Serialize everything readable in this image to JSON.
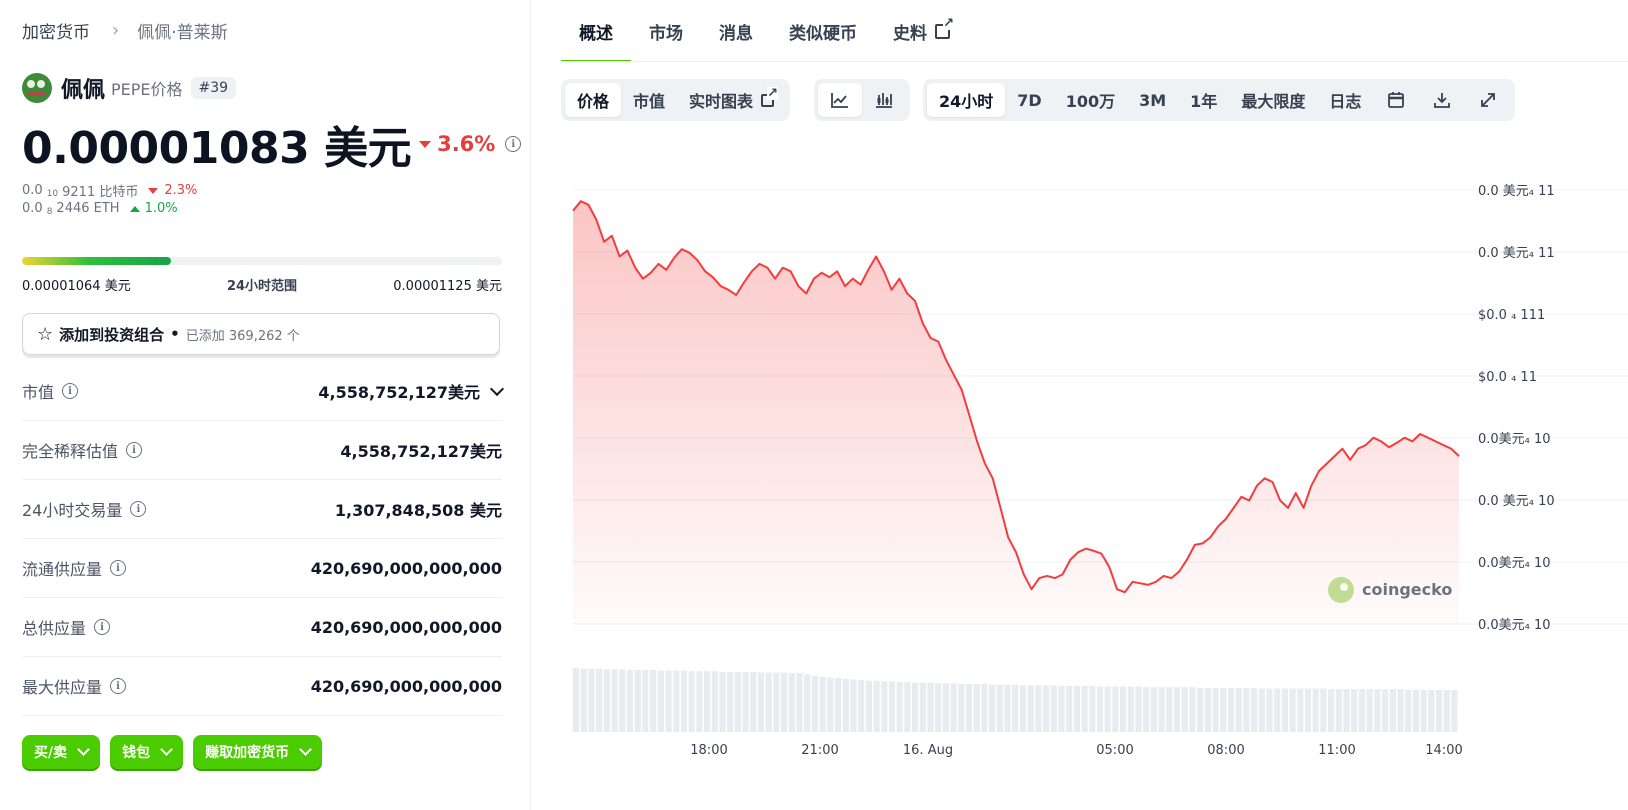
{
  "breadcrumb": {
    "root": "加密货币",
    "sep": "›",
    "current": "佩佩·普莱斯"
  },
  "coin": {
    "name": "佩佩",
    "symbol_label": "PEPE价格",
    "rank": "#39"
  },
  "price": {
    "value": "0.00001083 美元",
    "change": "3.6%",
    "change_dir": "down"
  },
  "sub": {
    "btc_prefix": "0.0",
    "btc_zeros": "10",
    "btc_digits": "9211 比特币",
    "btc_change": "2.3%",
    "eth_prefix": "0.0",
    "eth_zeros": "8",
    "eth_digits": "2446 ETH",
    "eth_change": "1.0%"
  },
  "range": {
    "low": "0.00001064 美元",
    "label": "24小时范围",
    "high": "0.00001125 美元",
    "position": 0.31
  },
  "portfolio": {
    "label": "添加到投资组合",
    "dot": "•",
    "count": "已添加 369,262 个"
  },
  "stats": [
    {
      "label": "市值",
      "value": "4,558,752,127美元"
    },
    {
      "label": "完全稀释估值",
      "value": "4,558,752,127美元"
    },
    {
      "label": "24小时交易量",
      "value": "1,307,848,508 美元"
    },
    {
      "label": "流通供应量",
      "value": "420,690,000,000,000"
    },
    {
      "label": "总供应量",
      "value": "420,690,000,000,000"
    },
    {
      "label": "最大供应量",
      "value": "420,690,000,000,000"
    }
  ],
  "actions": {
    "buy": "买/卖",
    "wallet": "钱包",
    "earn": "赚取加密货币"
  },
  "tabs": {
    "overview": "概述",
    "markets": "市场",
    "news": "消息",
    "similar": "类似硬币",
    "history": "史料"
  },
  "toolbar": {
    "price": "价格",
    "mcap": "市值",
    "live": "实时图表",
    "r24h": "24小时",
    "r7d": "7D",
    "r100": "100万",
    "r3m": "3M",
    "r1y": "1年",
    "rmax": "最大限度",
    "log": "日志"
  },
  "chart_data": {
    "type": "area",
    "y_tick_labels": [
      "0.0 美元₄ 11",
      "0.0 美元₄ 11",
      "$0.0 ₄ 111",
      "$0.0 ₄ 11",
      "0.0美元₄ 10",
      "0.0 美元₄ 10",
      "0.0美元₄ 10",
      "0.0美元₄ 10"
    ],
    "x_tick_labels": [
      "18:00",
      "21:00",
      "16. Aug",
      "05:00",
      "08:00",
      "11:00",
      "14:00"
    ],
    "watermark": "coingecko",
    "line_color": "#f23d3d",
    "price": [
      1.1162,
      1.1175,
      1.117,
      1.115,
      1.112,
      1.1128,
      1.11,
      1.1108,
      1.1085,
      1.107,
      1.1078,
      1.109,
      1.1082,
      1.1098,
      1.111,
      1.1105,
      1.1095,
      1.108,
      1.1072,
      1.106,
      1.1055,
      1.1048,
      1.1065,
      1.108,
      1.109,
      1.1085,
      1.107,
      1.1085,
      1.108,
      1.106,
      1.105,
      1.107,
      1.1078,
      1.1072,
      1.108,
      1.106,
      1.107,
      1.1062,
      1.1082,
      1.11,
      1.108,
      1.1055,
      1.107,
      1.105,
      1.104,
      1.101,
      1.099,
      1.0985,
      1.096,
      1.094,
      1.092,
      1.0885,
      1.085,
      1.082,
      1.08,
      1.076,
      1.072,
      1.07,
      1.067,
      1.065,
      1.0665,
      1.0668,
      1.0665,
      1.067,
      1.069,
      1.07,
      1.0705,
      1.0702,
      1.0698,
      1.068,
      1.065,
      1.0646,
      1.066,
      1.0658,
      1.0656,
      1.066,
      1.0668,
      1.0665,
      1.0674,
      1.069,
      1.071,
      1.0712,
      1.072,
      1.0735,
      1.0745,
      1.076,
      1.0775,
      1.077,
      1.079,
      1.08,
      1.0795,
      1.077,
      1.076,
      1.078,
      1.076,
      1.079,
      1.081,
      1.082,
      1.083,
      1.084,
      1.0825,
      1.084,
      1.0845,
      1.0855,
      1.085,
      1.0842,
      1.0848,
      1.0855,
      1.085,
      1.086,
      1.0855,
      1.085,
      1.0845,
      1.084,
      1.083
    ],
    "volume": [
      1.0,
      0.99,
      0.99,
      0.99,
      0.98,
      0.98,
      0.98,
      0.97,
      0.97,
      0.97,
      0.97,
      0.96,
      0.96,
      0.96,
      0.96,
      0.95,
      0.95,
      0.95,
      0.95,
      0.94,
      0.94,
      0.94,
      0.94,
      0.94,
      0.93,
      0.93,
      0.93,
      0.93,
      0.92,
      0.92,
      0.9,
      0.88,
      0.86,
      0.85,
      0.84,
      0.83,
      0.82,
      0.81,
      0.8,
      0.8,
      0.79,
      0.79,
      0.78,
      0.78,
      0.77,
      0.77,
      0.77,
      0.76,
      0.76,
      0.76,
      0.75,
      0.75,
      0.75,
      0.75,
      0.74,
      0.74,
      0.74,
      0.74,
      0.73,
      0.73,
      0.73,
      0.73,
      0.73,
      0.72,
      0.72,
      0.72,
      0.72,
      0.72,
      0.71,
      0.71,
      0.71,
      0.71,
      0.71,
      0.71,
      0.7,
      0.7,
      0.7,
      0.7,
      0.7,
      0.7,
      0.7,
      0.69,
      0.69,
      0.69,
      0.69,
      0.69,
      0.69,
      0.69,
      0.69,
      0.68,
      0.68,
      0.68,
      0.68,
      0.68,
      0.68,
      0.68,
      0.68,
      0.68,
      0.67,
      0.67,
      0.67,
      0.67,
      0.67,
      0.67,
      0.67,
      0.67,
      0.67,
      0.67,
      0.66,
      0.66,
      0.66,
      0.66,
      0.66,
      0.66,
      0.66
    ]
  }
}
